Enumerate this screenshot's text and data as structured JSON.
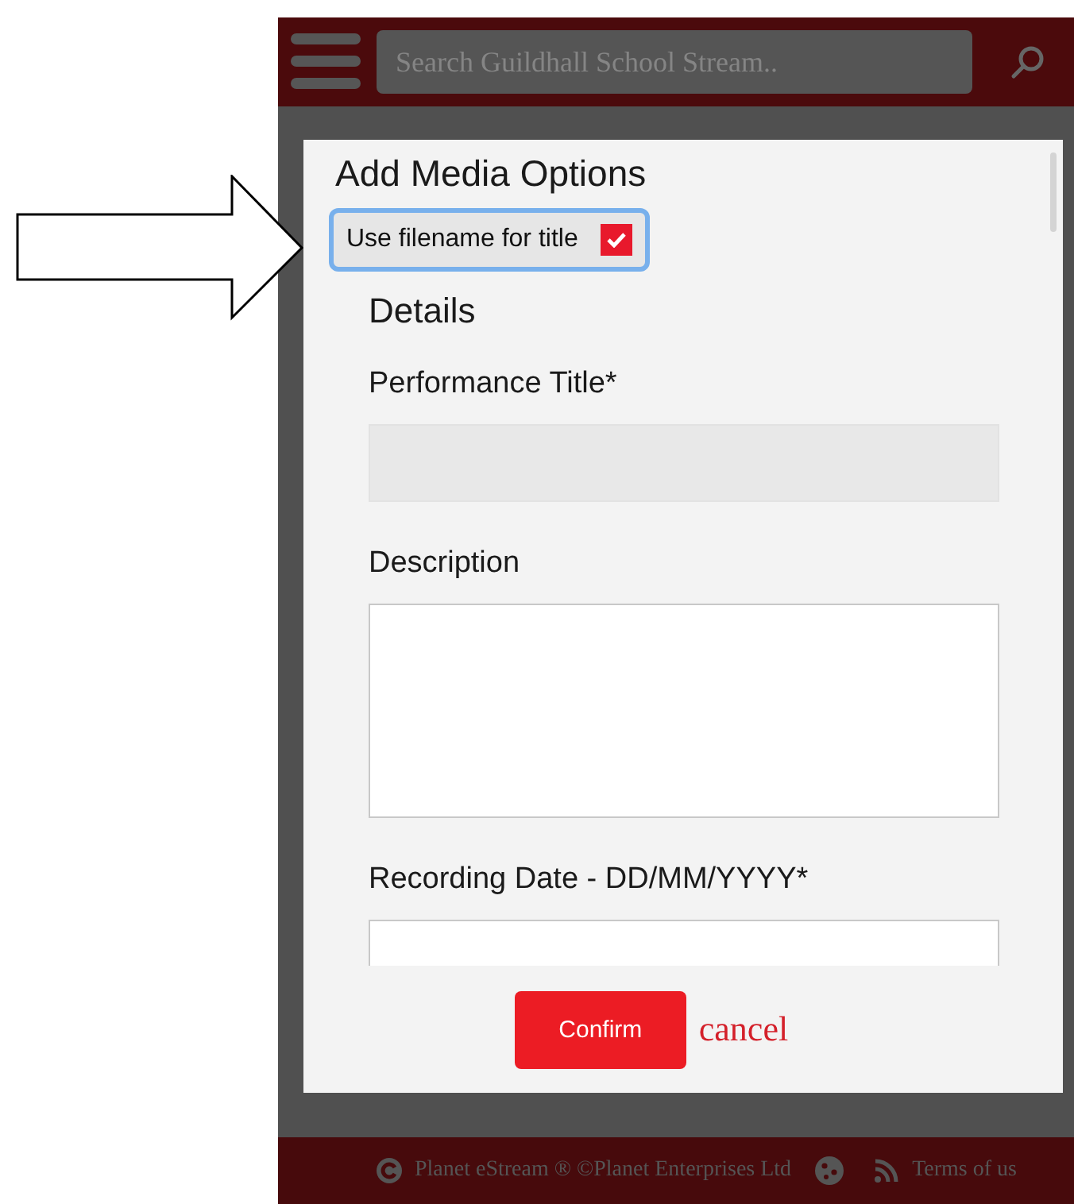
{
  "header": {
    "search_placeholder": "Search Guildhall School Stream.."
  },
  "dialog": {
    "title": "Add Media Options",
    "option": {
      "label": "Use filename for title",
      "checked": true
    },
    "section": "Details",
    "fields": [
      {
        "kind": "input",
        "label": "Performance Title*",
        "disabled": true
      },
      {
        "kind": "textarea",
        "label": "Description"
      },
      {
        "kind": "input",
        "label": "Recording Date - DD/MM/YYYY*",
        "disabled": false
      }
    ],
    "confirm": "Confirm",
    "cancel": "cancel"
  },
  "footer": {
    "copyright": "Planet eStream ® ©Planet Enterprises Ltd",
    "terms": "Terms of us"
  }
}
